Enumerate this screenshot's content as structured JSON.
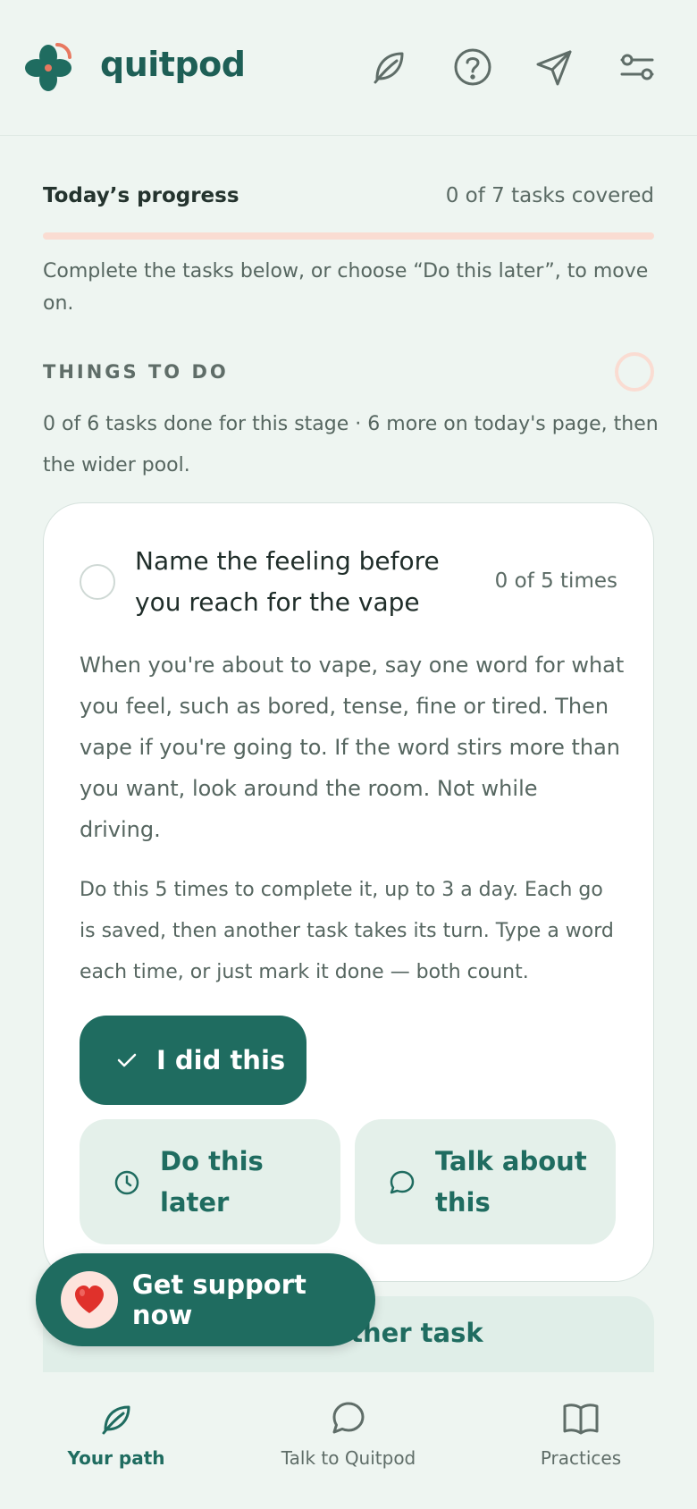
{
  "app": {
    "name": "quitpod"
  },
  "header": {
    "icons": [
      "leaf-icon",
      "help-circle-icon",
      "send-icon",
      "settings-sliders-icon"
    ]
  },
  "progress": {
    "label": "Today’s progress",
    "count_text": "0 of 7 tasks covered",
    "fraction": 0,
    "instruction": "Complete the tasks below, or choose “Do this later”, to move on."
  },
  "section": {
    "heading": "THINGS TO DO",
    "subtitle": "0 of 6 tasks done for this stage · 6 more on today's page, then the wider pool."
  },
  "task": {
    "title": "Name the feeling before you reach for the vape",
    "count_text": "0 of 5 times",
    "description": "When you're about to vape, say one word for what you feel, such as bored, tense, fine or tired. Then vape if you're going to. If the word stirs more than you want, look around the room. Not while driving.",
    "note": "Do this 5 times to complete it, up to 3 a day. Each go is saved, then another task takes its turn. Type a word each time, or just mark it done — both count.",
    "primary_label": "I did this",
    "later_label": "Do this later",
    "talk_label": "Talk about this"
  },
  "another_task_label": "Start another task",
  "support": {
    "label": "Get support now",
    "icon": "heart-icon"
  },
  "nav": [
    {
      "label": "Your path",
      "icon": "leaf-icon",
      "active": true
    },
    {
      "label": "Talk to Quitpod",
      "icon": "chat-bubble-icon",
      "active": false
    },
    {
      "label": "Practices",
      "icon": "book-icon",
      "active": false
    }
  ],
  "colors": {
    "primary": "#1f6c60",
    "background": "#eef5f1",
    "accent": "#e87860",
    "progress_track": "#fadcd2"
  }
}
